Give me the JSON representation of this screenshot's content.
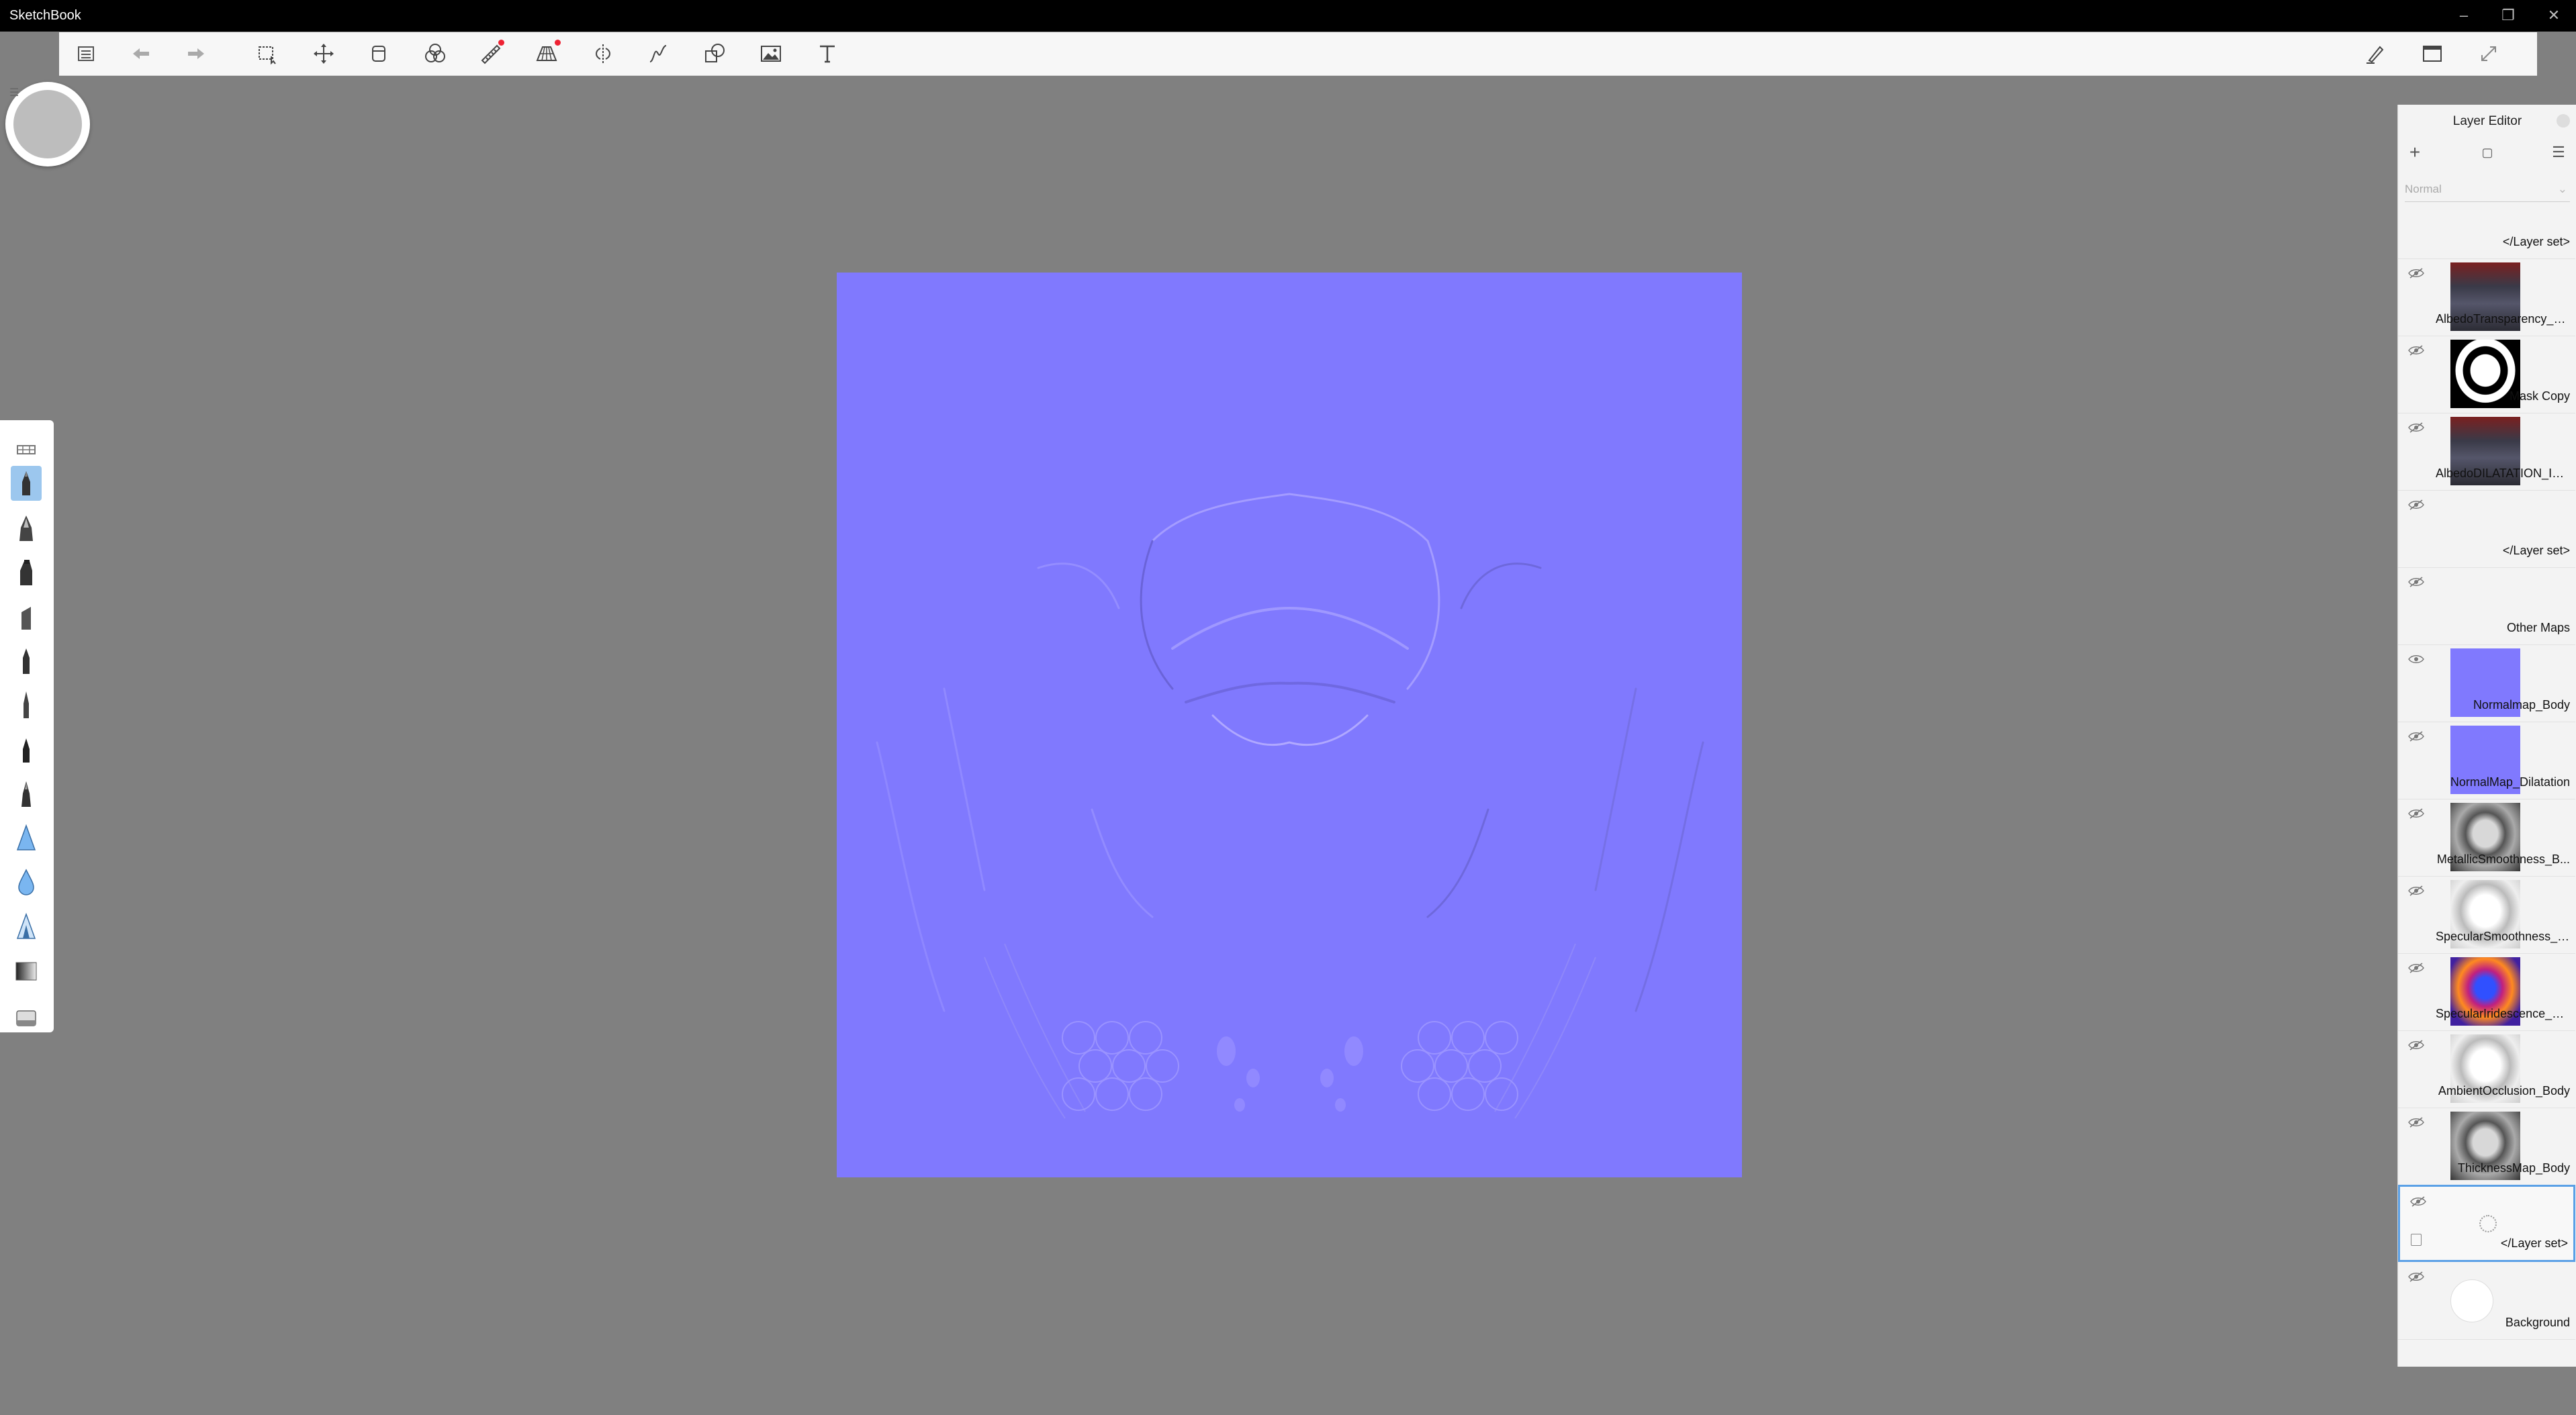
{
  "app": {
    "title": "SketchBook"
  },
  "window_controls": [
    "minimize",
    "restore",
    "close"
  ],
  "toolbar": {
    "items": [
      {
        "name": "lagoon-icon",
        "label": "Lagoon"
      },
      {
        "name": "undo-icon",
        "label": "Undo"
      },
      {
        "name": "redo-icon",
        "label": "Redo"
      },
      {
        "name": "select-icon",
        "label": "Select"
      },
      {
        "name": "transform-icon",
        "label": "Transform"
      },
      {
        "name": "crop-icon",
        "label": "Crop"
      },
      {
        "name": "color-adjust-icon",
        "label": "Color adjustments"
      },
      {
        "name": "ruler-icon",
        "label": "Ruler"
      },
      {
        "name": "perspective-icon",
        "label": "Perspective guide"
      },
      {
        "name": "symmetry-icon",
        "label": "Symmetry"
      },
      {
        "name": "curve-icon",
        "label": "Stroke tools"
      },
      {
        "name": "shapes-icon",
        "label": "Shapes"
      },
      {
        "name": "image-icon",
        "label": "Import image"
      },
      {
        "name": "text-icon",
        "label": "Text"
      }
    ],
    "right_items": [
      {
        "name": "brush-settings-icon",
        "label": "Brush settings"
      },
      {
        "name": "window-icon",
        "label": "Window"
      },
      {
        "name": "fullscreen-icon",
        "label": "Fullscreen"
      }
    ]
  },
  "brushes": [
    "brush-library-icon",
    "pencil-icon",
    "inking-pen-icon",
    "marker-icon",
    "chisel-marker-icon",
    "ballpoint-icon",
    "pen-icon",
    "fine-pen-icon",
    "calligraphy-icon",
    "airbrush-icon",
    "blur-icon",
    "smudge-icon",
    "gradient-icon",
    "eraser-icon"
  ],
  "layer_editor": {
    "title": "Layer Editor",
    "blend_mode": "Normal",
    "layers": [
      {
        "name": "</Layer set>",
        "thumb": "none",
        "visible": false
      },
      {
        "name": "AlbedoTransparency_B...",
        "thumb": "albedo",
        "visible": false
      },
      {
        "name": "Mask Copy",
        "thumb": "mask",
        "visible": false
      },
      {
        "name": "AlbedoDILATATION_IN...",
        "thumb": "albedo",
        "visible": false
      },
      {
        "name": "</Layer set>",
        "thumb": "none",
        "visible": false
      },
      {
        "name": "Other Maps",
        "thumb": "none",
        "visible": false
      },
      {
        "name": "Normalmap_Body",
        "thumb": "normal",
        "visible": true
      },
      {
        "name": "NormalMap_Dilatation",
        "thumb": "normal",
        "visible": false
      },
      {
        "name": "MetallicSmoothness_B...",
        "thumb": "gray",
        "visible": false
      },
      {
        "name": "SpecularSmoothness_B...",
        "thumb": "light",
        "visible": false
      },
      {
        "name": "SpecularIridescence_B...",
        "thumb": "iridescence",
        "visible": false
      },
      {
        "name": "AmbientOcclusion_Body",
        "thumb": "light",
        "visible": false
      },
      {
        "name": "ThicknessMap_Body",
        "thumb": "gray",
        "visible": false
      },
      {
        "name": "</Layer set>",
        "thumb": "loading",
        "visible": false,
        "selected": true
      },
      {
        "name": "Background",
        "thumb": "white",
        "visible": false
      }
    ]
  },
  "colors": {
    "background": "#808080",
    "canvas": "#8079fe",
    "titlebar": "#000000",
    "selection": "#5aa0e6"
  }
}
